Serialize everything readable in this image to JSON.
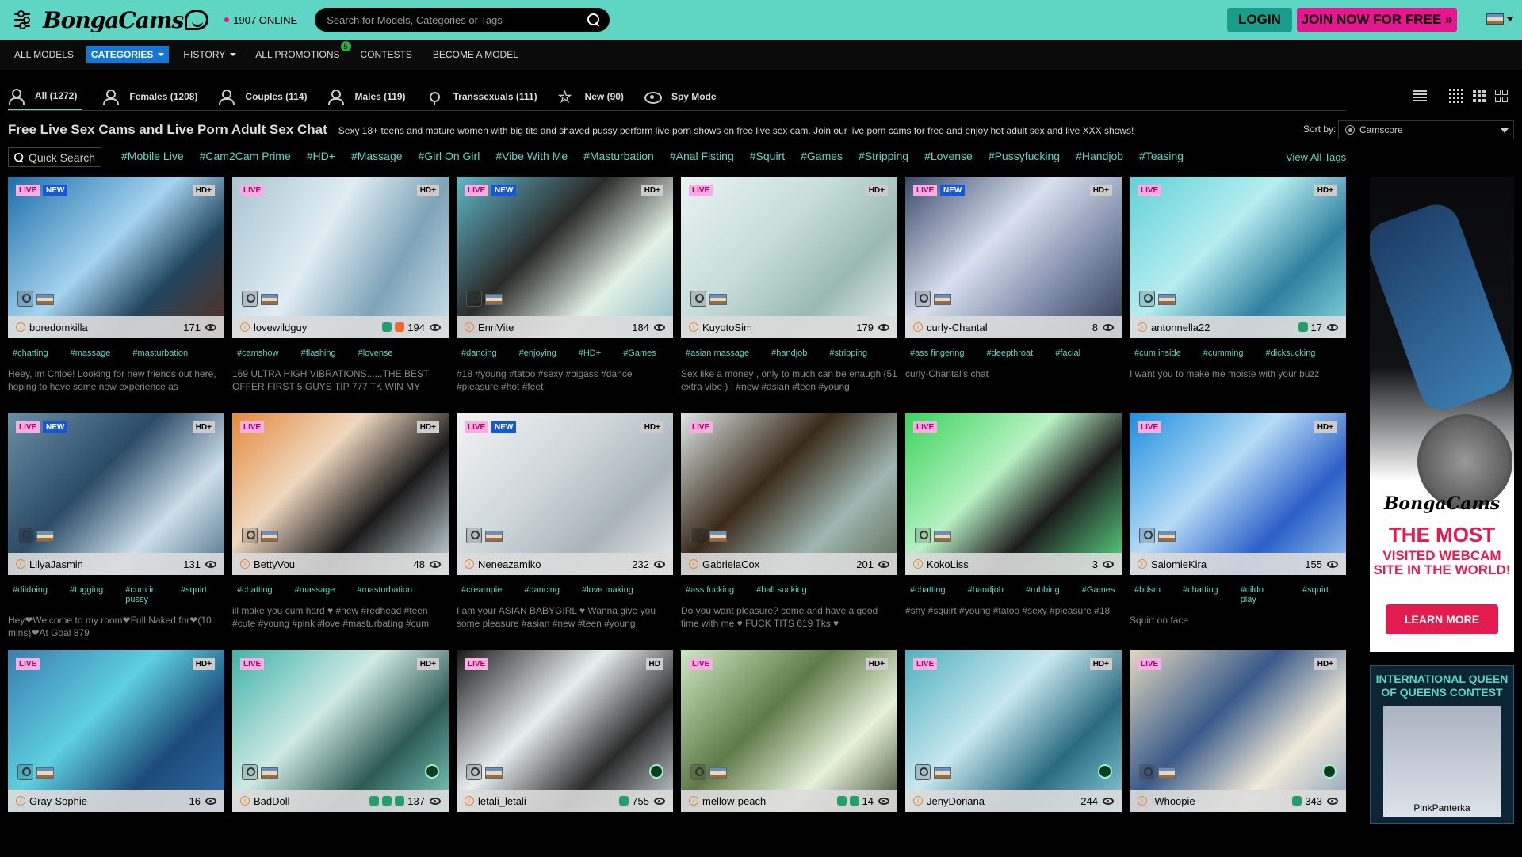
{
  "header": {
    "online_count": "1907 ONLINE",
    "search_placeholder": "Search for Models, Categories or Tags",
    "login": "LOGIN",
    "join": "JOIN NOW FOR FREE »"
  },
  "nav": {
    "items": [
      "ALL MODELS",
      "CATEGORIES",
      "HISTORY",
      "ALL PROMOTIONS",
      "CONTESTS",
      "BECOME A MODEL"
    ],
    "promo_badge": "5"
  },
  "tabs": [
    "All (1272)",
    "Females (1208)",
    "Couples (114)",
    "Males (119)",
    "Transsexuals (111)",
    "New (90)",
    "Spy Mode"
  ],
  "page": {
    "title": "Free Live Sex Cams and Live Porn Adult Sex Chat",
    "subtitle": "Sexy 18+ teens and mature women with big tits and shaved pussy perform live porn shows on free live sex cam. Join our live porn cams for free and enjoy hot adult sex and live XXX shows!",
    "sort_label": "Sort by:",
    "sort_value": "Camscore",
    "quick_search": "Quick Search",
    "view_all": "View All Tags"
  },
  "tag_row": [
    "#Mobile Live",
    "#Cam2Cam Prime",
    "#HD+",
    "#Massage",
    "#Girl On Girl",
    "#Vibe With Me",
    "#Masturbation",
    "#Anal Fisting",
    "#Squirt",
    "#Games",
    "#Stripping",
    "#Lovense",
    "#Pussyfucking",
    "#Handjob",
    "#Teasing"
  ],
  "badges": {
    "live": "LIVE",
    "new": "NEW",
    "hdplus": "HD+",
    "hd": "HD"
  },
  "models": [
    {
      "name": "boredomkilla",
      "count": "171",
      "tags": [
        "#chatting",
        "#massage",
        "#masturbation"
      ],
      "desc": "Heey, im Chloe! Looking for new friends out here, hoping to have some new experience as",
      "new": true,
      "hd": "HD+",
      "bg": "linear-gradient(135deg,#1c6ea8,#a5d4f0 45%,#22455e 70%,#5a2f1e)",
      "soc": []
    },
    {
      "name": "lovewildguy",
      "count": "194",
      "tags": [
        "#camshow",
        "#flashing",
        "#lovense"
      ],
      "desc": "169 ULTRA HIGH VIBRATIONS......THE BEST OFFER FIRST 5 GUYS TIP 777 TK WIN MY",
      "new": false,
      "hd": "HD+",
      "bg": "linear-gradient(120deg,#a8c5d1,#e0edf3 40%,#7ea3b8 70%,#cfe4ec)",
      "soc": [
        "ig",
        "tw"
      ]
    },
    {
      "name": "EnnVite",
      "count": "184",
      "tags": [
        "#dancing",
        "#enjoying",
        "#HD+",
        "#Games"
      ],
      "desc": "#18 #young #tatoo #sexy #bigass #dance #pleasure #hot #feet",
      "new": true,
      "hd": "HD+",
      "bg": "linear-gradient(135deg,#5fb7c9,#2a2a2a 40%,#e3f2e6 70%,#8ab7c4)",
      "soc": []
    },
    {
      "name": "KuyotoSim",
      "count": "179",
      "tags": [
        "#asian massage",
        "#handjob",
        "#stripping"
      ],
      "desc": "Sex like a money , only to much can be enaugh (51 extra vibe ) : #new #asian #teen #young",
      "new": false,
      "hd": "HD+",
      "bg": "linear-gradient(135deg,#e9f2f1,#c7dedb 40%,#9bb9b3 70%,#eef6f5)",
      "soc": []
    },
    {
      "name": "curly-Chantal",
      "count": "8",
      "tags": [
        "#ass fingering",
        "#deepthroat",
        "#facial"
      ],
      "desc": "curly-Chantal's chat",
      "new": true,
      "hd": "HD+",
      "bg": "linear-gradient(135deg,#3a4a6a,#d8e0ee 40%,#7d8aa8 70%,#2c3850)",
      "soc": []
    },
    {
      "name": "antonnella22",
      "count": "17",
      "tags": [
        "#cum inside",
        "#cumming",
        "#dicksucking"
      ],
      "desc": "I want you to make me moiste with your buzz",
      "new": false,
      "hd": "HD+",
      "bg": "linear-gradient(135deg,#5fd1d8,#b7eef0 40%,#2f7fa0 70%,#8adbe0)",
      "soc": [
        "ig"
      ]
    },
    {
      "name": "LilyaJasmin",
      "count": "131",
      "tags": [
        "#dildoing",
        "#tugging",
        "#cum in pussy",
        "#squirt"
      ],
      "desc": "Hey❤Welcome to my room❤Full Naked for❤(10 mins)❤At Goal 879",
      "new": true,
      "hd": "HD+",
      "bg": "linear-gradient(135deg,#6b8fa6,#2a4a66 40%,#cde0ea 70%,#4b6e85)",
      "soc": []
    },
    {
      "name": "BettyVou",
      "count": "48",
      "tags": [
        "#chatting",
        "#massage",
        "#masturbation"
      ],
      "desc": "ill make you cum hard ♥ #new #redhead #teen #cute #young #pink #love #masturbating #cum",
      "new": false,
      "hd": "HD+",
      "bg": "linear-gradient(135deg,#e58a3a,#f0d8c0 35%,#1a1a1a 65%,#d2e4ea)",
      "soc": []
    },
    {
      "name": "Neneazamiko",
      "count": "232",
      "tags": [
        "#creampie",
        "#dancing",
        "#love making"
      ],
      "desc": "I am your ASIAN BABYGIRL ♥ Wanna give you some pleasure #asian #new #teen #young",
      "new": true,
      "hd": "HD+",
      "bg": "linear-gradient(135deg,#f2f2f2,#cfd8dc 40%,#a9b4ba 70%,#eceff1)",
      "soc": []
    },
    {
      "name": "GabrielaCox",
      "count": "201",
      "tags": [
        "#ass fucking",
        "#ball sucking"
      ],
      "desc": "Do you want pleasure? come and have a good time with me ♥ FUCK TITS 619 Tks ♥",
      "new": false,
      "hd": "",
      "bg": "linear-gradient(135deg,#dbe6e4,#3a2a1a 40%,#9fb8b2 70%,#5d6a52)",
      "soc": []
    },
    {
      "name": "KokoLiss",
      "count": "3",
      "tags": [
        "#chatting",
        "#handjob",
        "#rubbing",
        "#Games"
      ],
      "desc": "#shy #squirt #young #tatoo #sexy #pleasure #18",
      "new": false,
      "hd": "",
      "bg": "linear-gradient(135deg,#3bd45c,#b8f2c4 40%,#1b1b1b 65%,#5ee08a)",
      "soc": []
    },
    {
      "name": "SalomieKira",
      "count": "155",
      "tags": [
        "#bdsm",
        "#chatting",
        "#dildo play",
        "#squirt"
      ],
      "desc": "Squirt on face",
      "new": false,
      "hd": "HD+",
      "bg": "linear-gradient(135deg,#1e8fe0,#b6dcf6 40%,#2a5fc8 70%,#9cc8ee)",
      "soc": []
    },
    {
      "name": "Gray-Sophie",
      "count": "16",
      "tags": [],
      "desc": "",
      "new": false,
      "hd": "HD+",
      "bg": "linear-gradient(135deg,#3a7db0,#5ed0e0 40%,#1c4a78 70%,#2f6ea8)",
      "soc": []
    },
    {
      "name": "BadDoll",
      "count": "137",
      "tags": [],
      "desc": "",
      "new": false,
      "hd": "HD+",
      "bg": "linear-gradient(135deg,#3fb4a8,#cfe9e4 40%,#2d5a55 70%,#7fd0c4)",
      "soc": [
        "ig",
        "cam",
        "tk"
      ]
    },
    {
      "name": "letali_letali",
      "count": "755",
      "tags": [],
      "desc": "",
      "new": false,
      "hd": "HD",
      "bg": "linear-gradient(135deg,#1a1a1a,#e8eef0 40%,#2a2a2a 70%,#cfd8dc)",
      "soc": [
        "ig"
      ]
    },
    {
      "name": "mellow-peach",
      "count": "14",
      "tags": [],
      "desc": "",
      "new": false,
      "hd": "HD+",
      "bg": "linear-gradient(135deg,#cde8c0,#5f7a48 40%,#e6f2dc 70%,#3c4a30)",
      "soc": [
        "ig",
        "cam"
      ]
    },
    {
      "name": "JenyDoriana",
      "count": "244",
      "tags": [],
      "desc": "",
      "new": false,
      "hd": "HD+",
      "bg": "linear-gradient(135deg,#4fb0c0,#c8e8ee 40%,#2a6a80 70%,#8ad0dc)",
      "soc": []
    },
    {
      "name": "-Whoopie-",
      "count": "343",
      "tags": [],
      "desc": "",
      "new": false,
      "hd": "HD+",
      "bg": "linear-gradient(135deg,#e0d8c0,#3a5a8a 40%,#f0ead8 70%,#8aa0c0)",
      "soc": [
        "ig"
      ]
    }
  ],
  "ads": {
    "logo": "BongaCams",
    "headline": "THE MOST",
    "subline": "VISITED WEBCAM SITE IN THE WORLD!",
    "button": "LEARN MORE",
    "contest_title": "INTERNATIONAL QUEEN OF QUEENS CONTEST",
    "contest_name": "PinkPanterka"
  },
  "logo_text": "BongaCams"
}
